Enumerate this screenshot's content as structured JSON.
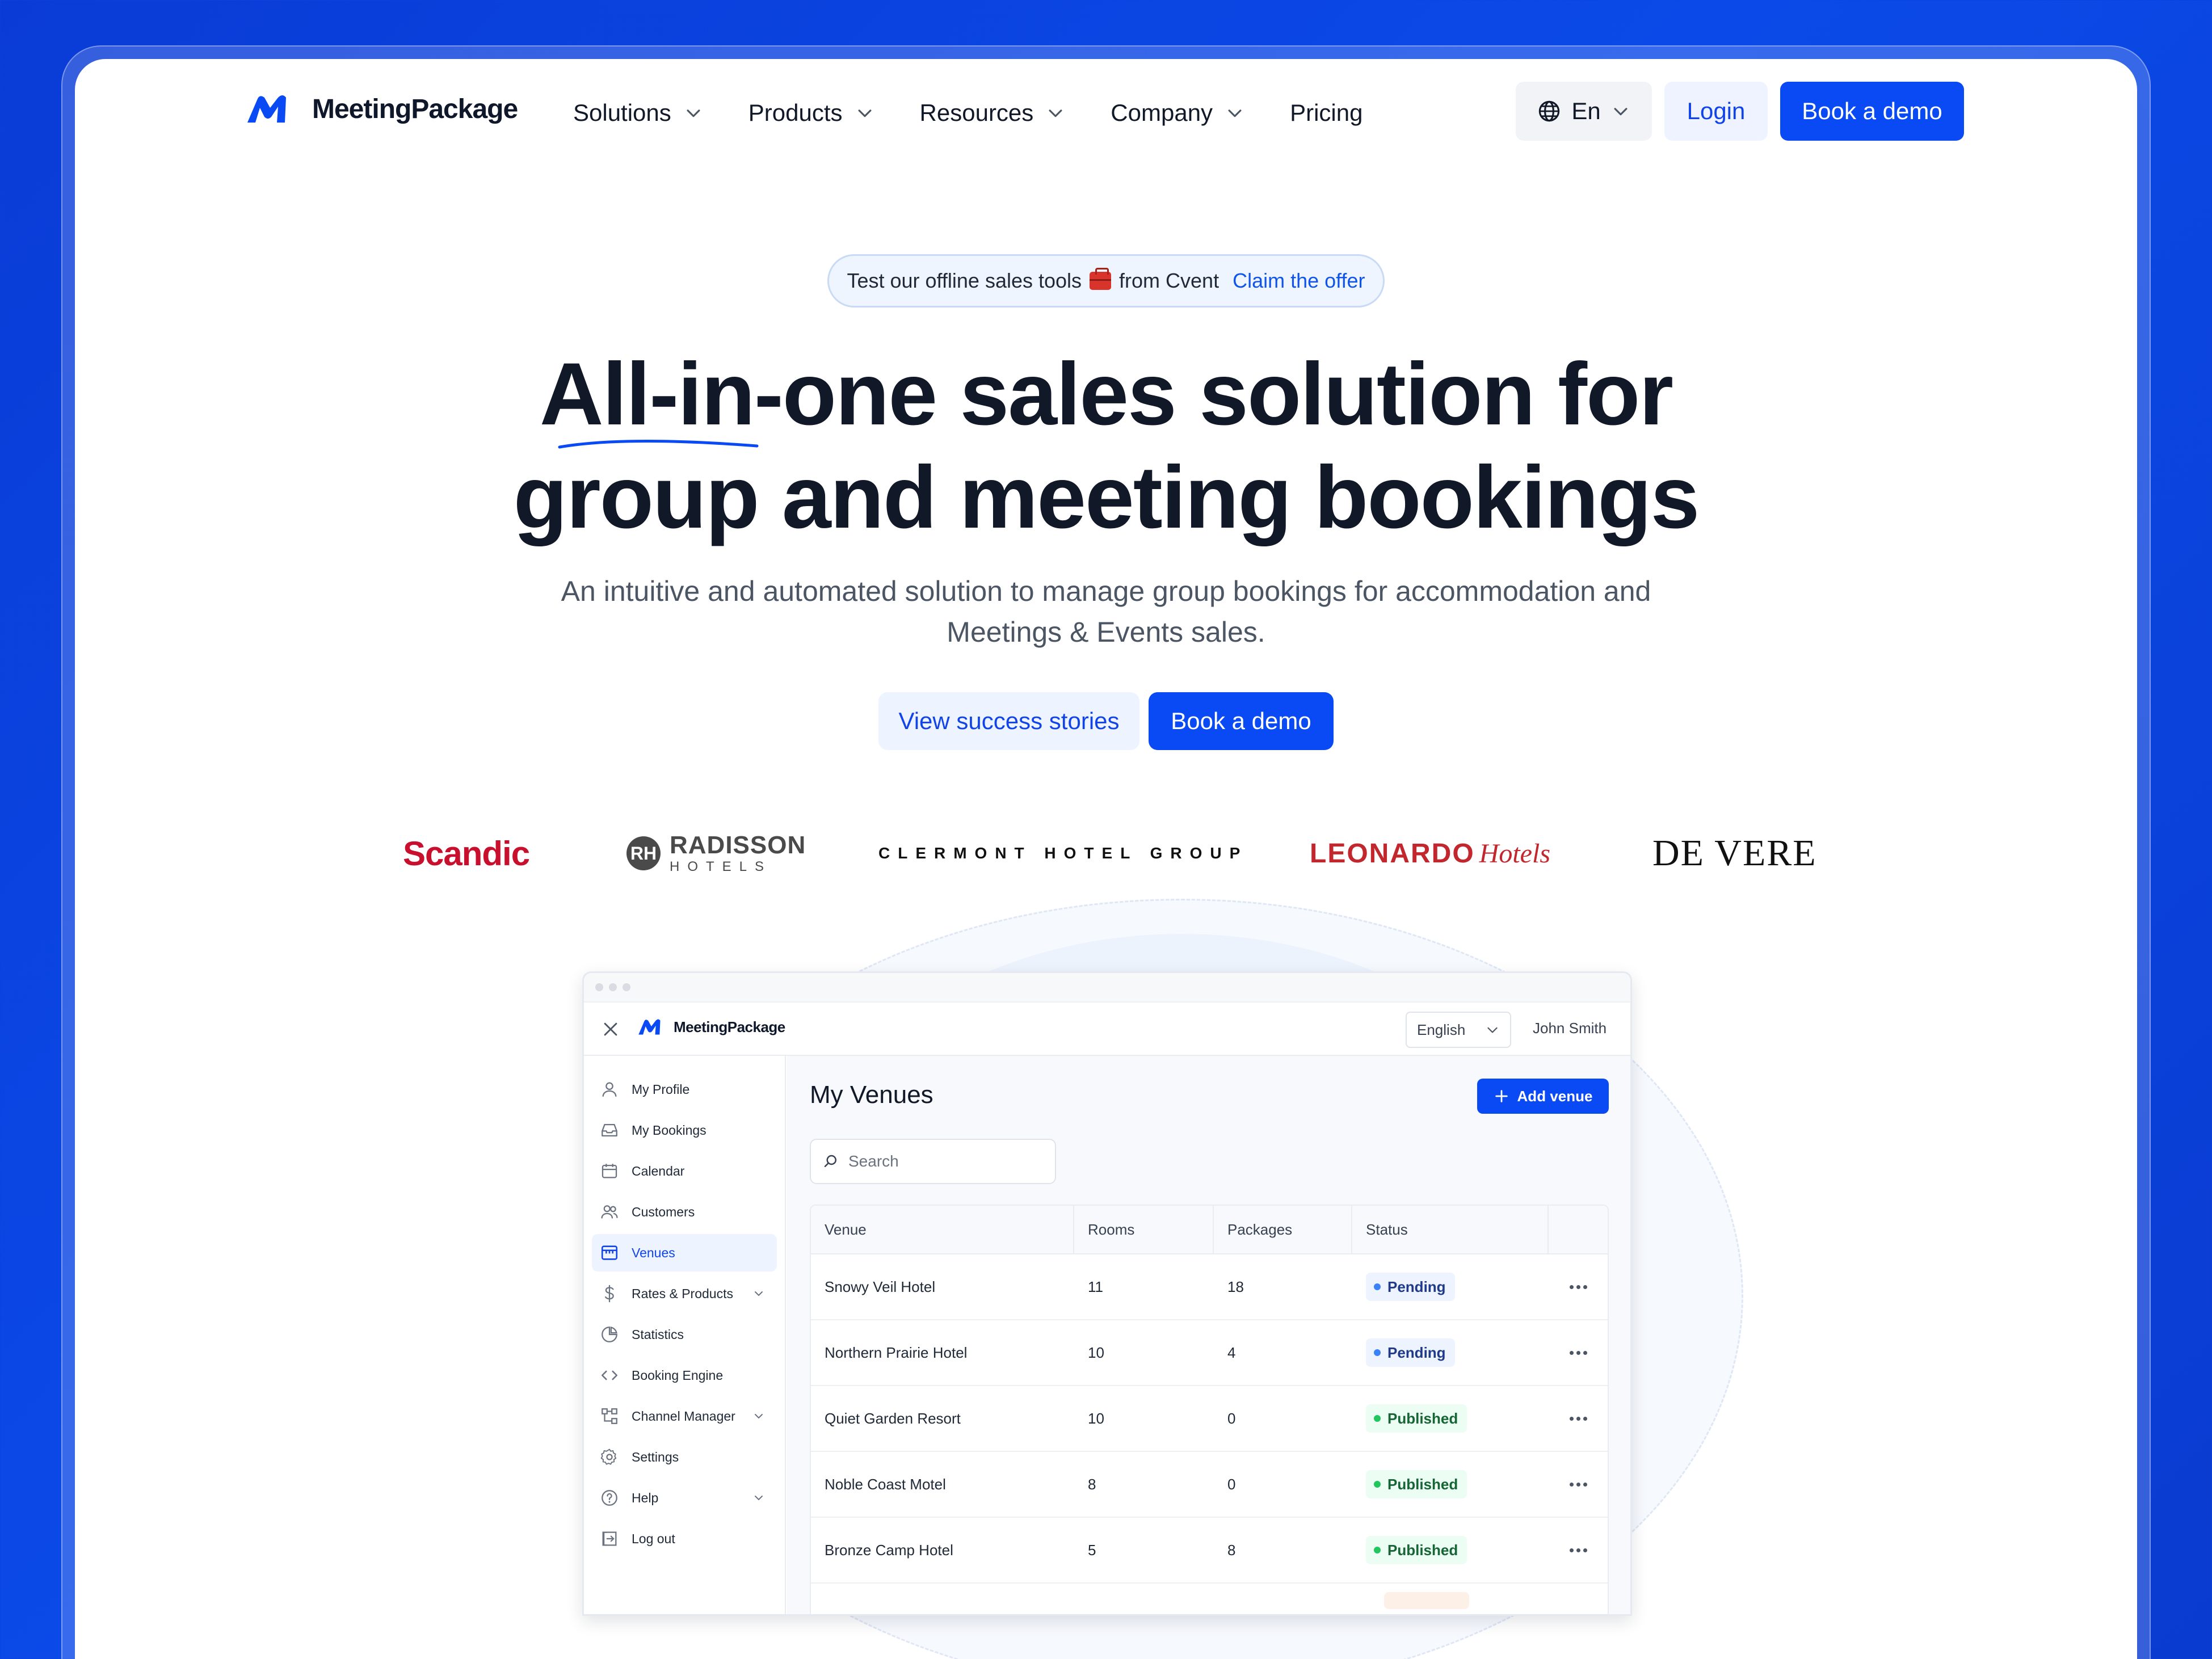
{
  "colors": {
    "primary": "#0a4af5",
    "background": "#0b4ae8",
    "pending": "#3b82f6",
    "published": "#22c55e"
  },
  "nav": {
    "brand": "MeetingPackage",
    "links": [
      {
        "label": "Solutions",
        "dropdown": true
      },
      {
        "label": "Products",
        "dropdown": true
      },
      {
        "label": "Resources",
        "dropdown": true
      },
      {
        "label": "Company",
        "dropdown": true
      },
      {
        "label": "Pricing",
        "dropdown": false
      }
    ],
    "language": "En",
    "login": "Login",
    "book_demo": "Book a demo"
  },
  "hero": {
    "promo_text_before": "Test our offline sales tools",
    "promo_text_after": "from Cvent",
    "promo_link": "Claim the offer",
    "headline_line1": "All-in-one sales solution for",
    "headline_line2": "group and meeting bookings",
    "subtext": "An intuitive and automated solution to manage group bookings for accommodation and Meetings & Events sales.",
    "cta_secondary": "View success stories",
    "cta_primary": "Book a demo"
  },
  "logos": {
    "scandic": "Scandic",
    "radisson_monogram": "RH",
    "radisson_1": "RADISSON",
    "radisson_2": "HOTELS",
    "clermont": "CLERMONT HOTEL GROUP",
    "leonardo_1": "LEONARDO",
    "leonardo_2": "Hotels",
    "devere": "DE VERE"
  },
  "app": {
    "brand": "MeetingPackage",
    "language": "English",
    "user": "John Smith",
    "sidebar": [
      {
        "label": "My Profile",
        "icon": "user-icon"
      },
      {
        "label": "My Bookings",
        "icon": "inbox-icon"
      },
      {
        "label": "Calendar",
        "icon": "calendar-icon"
      },
      {
        "label": "Customers",
        "icon": "users-icon"
      },
      {
        "label": "Venues",
        "icon": "store-icon",
        "active": true
      },
      {
        "label": "Rates & Products",
        "icon": "dollar-icon",
        "expandable": true
      },
      {
        "label": "Statistics",
        "icon": "pie-chart-icon"
      },
      {
        "label": "Booking Engine",
        "icon": "code-icon"
      },
      {
        "label": "Channel Manager",
        "icon": "workflow-icon",
        "expandable": true
      },
      {
        "label": "Settings",
        "icon": "gear-icon"
      },
      {
        "label": "Help",
        "icon": "help-icon",
        "expandable": true
      },
      {
        "label": "Log out",
        "icon": "logout-icon"
      }
    ],
    "page_title": "My Venues",
    "add_button": "Add venue",
    "search_placeholder": "Search",
    "table": {
      "headers": [
        "Venue",
        "Rooms",
        "Packages",
        "Status"
      ],
      "rows": [
        {
          "venue": "Snowy Veil Hotel",
          "rooms": "11",
          "packages": "18",
          "status": "Pending"
        },
        {
          "venue": "Northern Prairie Hotel",
          "rooms": "10",
          "packages": "4",
          "status": "Pending"
        },
        {
          "venue": "Quiet Garden Resort",
          "rooms": "10",
          "packages": "0",
          "status": "Published"
        },
        {
          "venue": "Noble Coast Motel",
          "rooms": "8",
          "packages": "0",
          "status": "Published"
        },
        {
          "venue": "Bronze Camp Hotel",
          "rooms": "5",
          "packages": "8",
          "status": "Published"
        }
      ]
    }
  }
}
